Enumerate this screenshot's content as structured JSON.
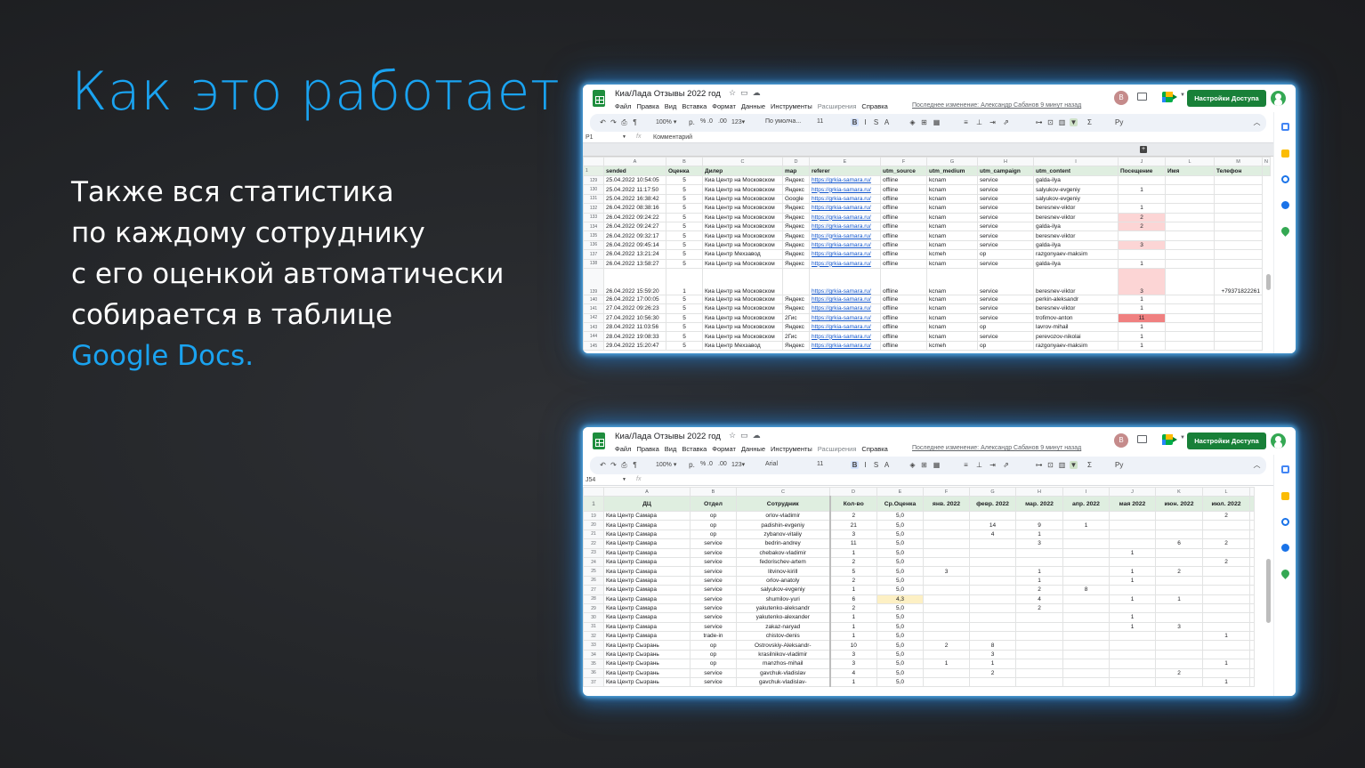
{
  "slide": {
    "title": "Как это работает",
    "line1": "Также вся статистика",
    "line2": "по каждому сотруднику",
    "line3": "с его оценкой автоматически",
    "line4": "собирается в таблице",
    "line5": "Google Docs."
  },
  "colors": {
    "accent": "#1aa3f0",
    "background": "#232528",
    "sheets_green": "#188038"
  },
  "sheet_common": {
    "doc_title": "Киа/Лада Отзывы 2022 год",
    "menus": [
      "Файл",
      "Правка",
      "Вид",
      "Вставка",
      "Формат",
      "Данные",
      "Инструменты",
      "Расширения",
      "Справка"
    ],
    "last_edit": "Последнее изменение: Александр Сабанов 9 минут назад",
    "avatar_letter": "В",
    "share_label": "Настройки Доступа",
    "zoom": "100%",
    "font_size": "11",
    "number_format": "123"
  },
  "sheet1": {
    "font_name": "По умолча...",
    "cell_ref": "P1",
    "formula_value": "Комментарий",
    "col_letters": [
      "A",
      "B",
      "C",
      "D",
      "E",
      "F",
      "G",
      "H",
      "I",
      "J",
      "L",
      "M",
      "N"
    ],
    "headers": [
      "sended",
      "Оценка",
      "Дилер",
      "map",
      "referer",
      "utm_source",
      "utm_medium",
      "utm_campaign",
      "utm_content",
      "Посещение",
      "Имя",
      "Телефон"
    ],
    "rows": [
      {
        "n": "129",
        "sended": "25.04.2022 10:54:05",
        "score": "5",
        "dealer": "Киа Центр на Московском",
        "map": "Яндекс",
        "ref": "https://grkia-samara.ru/",
        "src": "offline",
        "med": "kcnam",
        "camp": "service",
        "cont": "galda-ilya",
        "visit": "",
        "vc": "",
        "name": "",
        "phone": ""
      },
      {
        "n": "130",
        "sended": "25.04.2022 11:17:50",
        "score": "5",
        "dealer": "Киа Центр на Московском",
        "map": "Яндекс",
        "ref": "https://grkia-samara.ru/",
        "src": "offline",
        "med": "kcnam",
        "camp": "service",
        "cont": "salyukov-evgeniy",
        "visit": "1",
        "vc": "",
        "name": "",
        "phone": ""
      },
      {
        "n": "131",
        "sended": "25.04.2022 16:38:42",
        "score": "5",
        "dealer": "Киа Центр на Московском",
        "map": "Google",
        "ref": "https://grkia-samara.ru/",
        "src": "offline",
        "med": "kcnam",
        "camp": "service",
        "cont": "salyukov-evgeniy",
        "visit": "",
        "vc": "",
        "name": "",
        "phone": ""
      },
      {
        "n": "132",
        "sended": "26.04.2022 08:38:16",
        "score": "5",
        "dealer": "Киа Центр на Московском",
        "map": "Яндекс",
        "ref": "https://grkia-samara.ru/",
        "src": "offline",
        "med": "kcnam",
        "camp": "service",
        "cont": "beresnev-viktor",
        "visit": "1",
        "vc": "",
        "name": "",
        "phone": ""
      },
      {
        "n": "133",
        "sended": "26.04.2022 09:24:22",
        "score": "5",
        "dealer": "Киа Центр на Московском",
        "map": "Яндекс",
        "ref": "https://grkia-samara.ru/",
        "src": "offline",
        "med": "kcnam",
        "camp": "service",
        "cont": "beresnev-viktor",
        "visit": "2",
        "vc": "pink",
        "name": "",
        "phone": ""
      },
      {
        "n": "134",
        "sended": "26.04.2022 09:24:27",
        "score": "5",
        "dealer": "Киа Центр на Московском",
        "map": "Яндекс",
        "ref": "https://grkia-samara.ru/",
        "src": "offline",
        "med": "kcnam",
        "camp": "service",
        "cont": "galda-ilya",
        "visit": "2",
        "vc": "pink",
        "name": "",
        "phone": ""
      },
      {
        "n": "135",
        "sended": "26.04.2022 09:32:17",
        "score": "5",
        "dealer": "Киа Центр на Московском",
        "map": "Яндекс",
        "ref": "https://grkia-samara.ru/",
        "src": "offline",
        "med": "kcnam",
        "camp": "service",
        "cont": "beresnev-viktor",
        "visit": "",
        "vc": "",
        "name": "",
        "phone": ""
      },
      {
        "n": "136",
        "sended": "26.04.2022 09:45:14",
        "score": "5",
        "dealer": "Киа Центр на Московском",
        "map": "Яндекс",
        "ref": "https://grkia-samara.ru/",
        "src": "offline",
        "med": "kcnam",
        "camp": "service",
        "cont": "galda-ilya",
        "visit": "3",
        "vc": "pink",
        "name": "",
        "phone": ""
      },
      {
        "n": "137",
        "sended": "26.04.2022 13:21:24",
        "score": "5",
        "dealer": "Киа Центр Мехзавод",
        "map": "Яндекс",
        "ref": "https://grkia-samara.ru/",
        "src": "offline",
        "med": "kcmeh",
        "camp": "op",
        "cont": "razgonyaev-maksim",
        "visit": "",
        "vc": "",
        "name": "",
        "phone": ""
      },
      {
        "n": "138",
        "sended": "26.04.2022 13:58:27",
        "score": "5",
        "dealer": "Киа Центр на Московском",
        "map": "Яндекс",
        "ref": "https://grkia-samara.ru/",
        "src": "offline",
        "med": "kcnam",
        "camp": "service",
        "cont": "galda-ilya",
        "visit": "1",
        "vc": "",
        "name": "",
        "phone": ""
      },
      {
        "n": "139",
        "sended": "26.04.2022 15:59:20",
        "score": "1",
        "dealer": "Киа Центр на Московском",
        "map": "",
        "ref": "https://grkia-samara.ru/",
        "src": "offline",
        "med": "kcnam",
        "camp": "service",
        "cont": "beresnev-viktor",
        "visit": "3",
        "vc": "pink",
        "name": "",
        "phone": "+79371822261",
        "tall": true
      },
      {
        "n": "140",
        "sended": "26.04.2022 17:00:05",
        "score": "5",
        "dealer": "Киа Центр на Московском",
        "map": "Яндекс",
        "ref": "https://grkia-samara.ru/",
        "src": "offline",
        "med": "kcnam",
        "camp": "service",
        "cont": "perkin-aleksandr",
        "visit": "1",
        "vc": "",
        "name": "",
        "phone": ""
      },
      {
        "n": "141",
        "sended": "27.04.2022 09:26:23",
        "score": "5",
        "dealer": "Киа Центр на Московском",
        "map": "Яндекс",
        "ref": "https://grkia-samara.ru/",
        "src": "offline",
        "med": "kcnam",
        "camp": "service",
        "cont": "beresnev-viktor",
        "visit": "1",
        "vc": "",
        "name": "",
        "phone": ""
      },
      {
        "n": "142",
        "sended": "27.04.2022 10:56:30",
        "score": "5",
        "dealer": "Киа Центр на Московском",
        "map": "2Гис",
        "ref": "https://grkia-samara.ru/",
        "src": "offline",
        "med": "kcnam",
        "camp": "service",
        "cont": "trofimov-anton",
        "visit": "11",
        "vc": "red",
        "name": "",
        "phone": ""
      },
      {
        "n": "143",
        "sended": "28.04.2022 11:03:56",
        "score": "5",
        "dealer": "Киа Центр на Московском",
        "map": "Яндекс",
        "ref": "https://grkia-samara.ru/",
        "src": "offline",
        "med": "kcnam",
        "camp": "op",
        "cont": "lavrov-mihail",
        "visit": "1",
        "vc": "",
        "name": "",
        "phone": ""
      },
      {
        "n": "144",
        "sended": "28.04.2022 19:08:33",
        "score": "5",
        "dealer": "Киа Центр на Московском",
        "map": "2Гис",
        "ref": "https://grkia-samara.ru/",
        "src": "offline",
        "med": "kcnam",
        "camp": "service",
        "cont": "perevozov-nikolai",
        "visit": "1",
        "vc": "",
        "name": "",
        "phone": ""
      },
      {
        "n": "145",
        "sended": "29.04.2022 15:20:47",
        "score": "5",
        "dealer": "Киа Центр Мехзавод",
        "map": "Яндекс",
        "ref": "https://grkia-samara.ru/",
        "src": "offline",
        "med": "kcmeh",
        "camp": "op",
        "cont": "razgonyaev-maksim",
        "visit": "1",
        "vc": "",
        "name": "",
        "phone": ""
      }
    ]
  },
  "sheet2": {
    "font_name": "Arial",
    "cell_ref": "J54",
    "col_letters": [
      "A",
      "B",
      "C",
      "D",
      "E",
      "F",
      "G",
      "H",
      "I",
      "J",
      "K",
      "L"
    ],
    "headers": [
      "ДЦ",
      "Отдел",
      "Сотрудник",
      "Кол-во",
      "Ср.Оценка",
      "янв. 2022",
      "февр. 2022",
      "мар. 2022",
      "апр. 2022",
      "мая 2022",
      "июн. 2022",
      "июл. 2022"
    ],
    "rows": [
      {
        "n": "19",
        "dc": "Киа Центр Самара",
        "dept": "op",
        "emp": "orlov-vladimir",
        "cnt": "2",
        "avg": "5,0",
        "m": [
          "",
          "",
          "",
          "",
          "",
          "",
          "2"
        ]
      },
      {
        "n": "20",
        "dc": "Киа Центр Самара",
        "dept": "op",
        "emp": "padishin-evgeniy",
        "cnt": "21",
        "avg": "5,0",
        "m": [
          "",
          "14",
          "9",
          "1",
          "",
          "",
          ""
        ]
      },
      {
        "n": "21",
        "dc": "Киа Центр Самара",
        "dept": "op",
        "emp": "zybanov-vitaliy",
        "cnt": "3",
        "avg": "5,0",
        "m": [
          "",
          "4",
          "1",
          "",
          "",
          "",
          ""
        ]
      },
      {
        "n": "22",
        "dc": "Киа Центр Самара",
        "dept": "service",
        "emp": "bedrin-andrey",
        "cnt": "11",
        "avg": "5,0",
        "m": [
          "",
          "",
          "3",
          "",
          "",
          "6",
          "2"
        ]
      },
      {
        "n": "23",
        "dc": "Киа Центр Самара",
        "dept": "service",
        "emp": "chebakov-vladimir",
        "cnt": "1",
        "avg": "5,0",
        "m": [
          "",
          "",
          "",
          "",
          "1",
          "",
          ""
        ]
      },
      {
        "n": "24",
        "dc": "Киа Центр Самара",
        "dept": "service",
        "emp": "fedorischev-artem",
        "cnt": "2",
        "avg": "5,0",
        "m": [
          "",
          "",
          "",
          "",
          "",
          "",
          "2"
        ]
      },
      {
        "n": "25",
        "dc": "Киа Центр Самара",
        "dept": "service",
        "emp": "litvinov-kirill",
        "cnt": "5",
        "avg": "5,0",
        "m": [
          "3",
          "",
          "1",
          "",
          "1",
          "2",
          ""
        ]
      },
      {
        "n": "26",
        "dc": "Киа Центр Самара",
        "dept": "service",
        "emp": "orlov-anatoly",
        "cnt": "2",
        "avg": "5,0",
        "m": [
          "",
          "",
          "1",
          "",
          "1",
          "",
          ""
        ]
      },
      {
        "n": "27",
        "dc": "Киа Центр Самара",
        "dept": "service",
        "emp": "salyukov-evgeniy",
        "cnt": "1",
        "avg": "5,0",
        "m": [
          "",
          "",
          "2",
          "8",
          "",
          "",
          ""
        ]
      },
      {
        "n": "28",
        "dc": "Киа Центр Самара",
        "dept": "service",
        "emp": "shumilov-yuri",
        "cnt": "6",
        "avg": "4,3",
        "avgc": "yel",
        "m": [
          "",
          "",
          "4",
          "",
          "1",
          "1",
          ""
        ]
      },
      {
        "n": "29",
        "dc": "Киа Центр Самара",
        "dept": "service",
        "emp": "yakutenko-aleksandr",
        "cnt": "2",
        "avg": "5,0",
        "m": [
          "",
          "",
          "2",
          "",
          "",
          "",
          ""
        ]
      },
      {
        "n": "30",
        "dc": "Киа Центр Самара",
        "dept": "service",
        "emp": "yakutenko-alexander",
        "cnt": "1",
        "avg": "5,0",
        "m": [
          "",
          "",
          "",
          "",
          "1",
          "",
          ""
        ]
      },
      {
        "n": "31",
        "dc": "Киа Центр Самара",
        "dept": "service",
        "emp": "zakaz-naryad",
        "cnt": "1",
        "avg": "5,0",
        "m": [
          "",
          "",
          "",
          "",
          "1",
          "3",
          ""
        ]
      },
      {
        "n": "32",
        "dc": "Киа Центр Самара",
        "dept": "trade-in",
        "emp": "chistov-denis",
        "cnt": "1",
        "avg": "5,0",
        "m": [
          "",
          "",
          "",
          "",
          "",
          "",
          "1"
        ]
      },
      {
        "n": "33",
        "dc": "Киа Центр Сызрань",
        "dept": "op",
        "emp": "Ostrovskiy-Aleksandr-",
        "cnt": "10",
        "avg": "5,0",
        "m": [
          "2",
          "8",
          "",
          "",
          "",
          "",
          ""
        ]
      },
      {
        "n": "34",
        "dc": "Киа Центр Сызрань",
        "dept": "op",
        "emp": "krasilnikov-vladimir",
        "cnt": "3",
        "avg": "5,0",
        "m": [
          "",
          "3",
          "",
          "",
          "",
          "",
          ""
        ]
      },
      {
        "n": "35",
        "dc": "Киа Центр Сызрань",
        "dept": "op",
        "emp": "manzhos-mihail",
        "cnt": "3",
        "avg": "5,0",
        "m": [
          "1",
          "1",
          "",
          "",
          "",
          "",
          "1"
        ]
      },
      {
        "n": "36",
        "dc": "Киа Центр Сызрань",
        "dept": "service",
        "emp": "gavchuk-vladislav",
        "cnt": "4",
        "avg": "5,0",
        "m": [
          "",
          "2",
          "",
          "",
          "",
          "2",
          ""
        ]
      },
      {
        "n": "37",
        "dc": "Киа Центр Сызрань",
        "dept": "service",
        "emp": "gavchuk-vladislav-",
        "cnt": "1",
        "avg": "5,0",
        "m": [
          "",
          "",
          "",
          "",
          "",
          "",
          "1"
        ]
      }
    ]
  }
}
